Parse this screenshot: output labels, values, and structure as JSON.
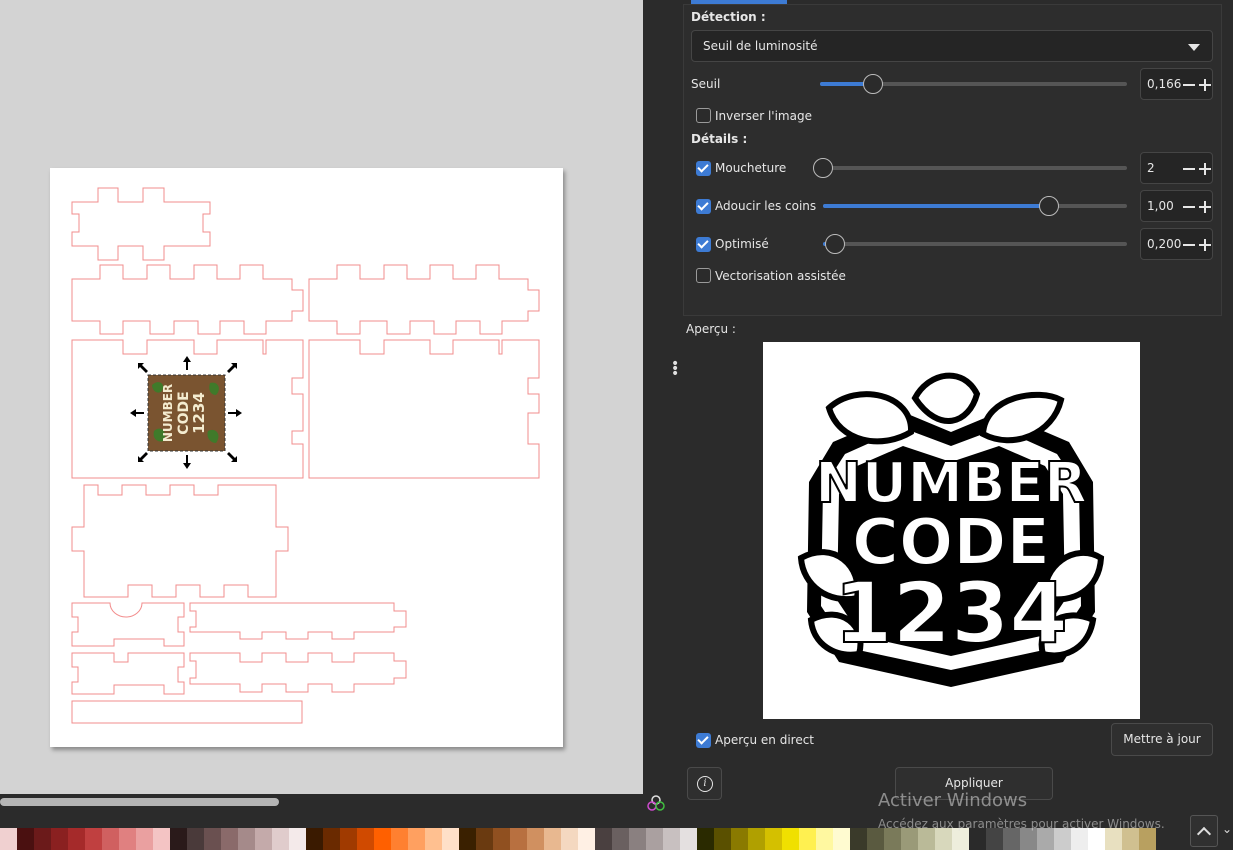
{
  "panel": {
    "detection": {
      "heading": "Détection :",
      "mode_selected": "Seuil de luminosité",
      "threshold_label": "Seuil",
      "threshold_value": "0,166",
      "threshold_fraction": 0.166,
      "invert_label": "Inverser l'image",
      "invert_checked": false
    },
    "details": {
      "heading": "Détails :",
      "speckles_label": "Moucheture",
      "speckles_value": "2",
      "speckles_checked": true,
      "speckles_fraction": 0.0,
      "smooth_label": "Adoucir les coins",
      "smooth_value": "1,00",
      "smooth_checked": true,
      "smooth_fraction": 0.74,
      "optimize_label": "Optimisé",
      "optimize_value": "0,200",
      "optimize_checked": true,
      "optimize_fraction": 0.04,
      "assisted_label": "Vectorisation assistée",
      "assisted_checked": false
    },
    "preview": {
      "label": "Aperçu :",
      "logo_line1": "NUMBER",
      "logo_line2": "CODE",
      "logo_line3": "1234",
      "live_label": "Aperçu en direct",
      "live_checked": true,
      "update_button": "Mettre à jour"
    },
    "apply_button": "Appliquer"
  },
  "canvas": {
    "selected_image": {
      "line1": "NUMBER",
      "line2": "CODE",
      "line3": "1234"
    }
  },
  "watermark": {
    "title": "Activer Windows",
    "subtitle": "Accédez aux paramètres pour activer Windows."
  },
  "palette": {
    "colors": [
      "#f0d0d0",
      "#4a1010",
      "#6b1a1a",
      "#8a2020",
      "#a52a2a",
      "#c04040",
      "#d06060",
      "#e08080",
      "#eaa0a0",
      "#f4c4c4",
      "#2a1a1a",
      "#4a3a3a",
      "#6a5050",
      "#8a6a6a",
      "#a58a8a",
      "#c4aaaa",
      "#e0cccc",
      "#f4eaea",
      "#3a1a00",
      "#6a2a00",
      "#a03a00",
      "#d04a00",
      "#ff6000",
      "#ff8030",
      "#ffa060",
      "#ffc090",
      "#ffe0c8",
      "#3a2000",
      "#6a3a10",
      "#905020",
      "#b87040",
      "#d09060",
      "#e8b890",
      "#f4d8c0",
      "#fff0e4",
      "#4a4040",
      "#6a6060",
      "#8a8080",
      "#aaa0a0",
      "#c8c0c0",
      "#e4e0e0",
      "#2a2a00",
      "#5a5000",
      "#8a7a00",
      "#b0a000",
      "#d4c000",
      "#f0e000",
      "#fff050",
      "#fff8a0",
      "#fffbd0",
      "#3a3a2a",
      "#5a5a40",
      "#7a7a5a",
      "#9a9a78",
      "#baba98",
      "#d8d8bc",
      "#eeeedc",
      "#2a2a2a",
      "#444444",
      "#666666",
      "#888888",
      "#aaaaaa",
      "#cccccc",
      "#eeeeee",
      "#ffffff",
      "#e8e0c0",
      "#d0c090",
      "#b8a060"
    ]
  }
}
